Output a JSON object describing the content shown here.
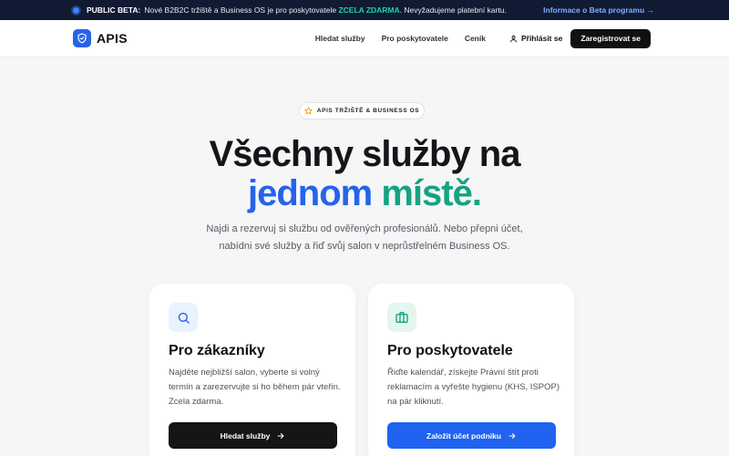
{
  "banner": {
    "tag": "PUBLIC BETA:",
    "text_before": "Nové B2B2C tržiště a Business OS je pro poskytovatele",
    "highlight": "ZCELA ZDARMA",
    "text_after": ". Nevyžadujeme platební kartu.",
    "info_link": "Informace o Beta programu →"
  },
  "nav": {
    "brand": "APIS",
    "links": [
      "Hledat služby",
      "Pro poskytovatele",
      "Ceník"
    ],
    "login": "Přihlásit se",
    "register": "Zaregistrovat se"
  },
  "hero": {
    "pill": "APIS TRŽIŠTĚ & BUSINESS OS",
    "title_line1": "Všechny služby na",
    "title_blue": "jednom",
    "title_green": "místě",
    "title_dot": ".",
    "lead_line1": "Najdi a rezervuj si službu od ověřených profesionálů. Nebo přepni účet,",
    "lead_line2": "nabídni své služby a řiď svůj salon v neprůstřelném Business OS."
  },
  "cards": [
    {
      "title": "Pro zákazníky",
      "description": "Najděte nejbližší salon, vyberte si volný termín a zarezervujte si ho během pár vteřin. Zcela zdarma.",
      "button": "Hledat služby",
      "icon": "search-icon"
    },
    {
      "title": "Pro poskytovatele",
      "description": "Řiďte kalendář, získejte Právní štít proti reklamacím a vyřešte hygienu (KHS, ISPOP) na pár kliknutí.",
      "button": "Založit účet podniku",
      "icon": "briefcase-icon"
    }
  ],
  "colors": {
    "accent": "#2563eb",
    "green": "#14a383",
    "banner_bg": "#111a33",
    "free_green": "#22d3a5"
  }
}
